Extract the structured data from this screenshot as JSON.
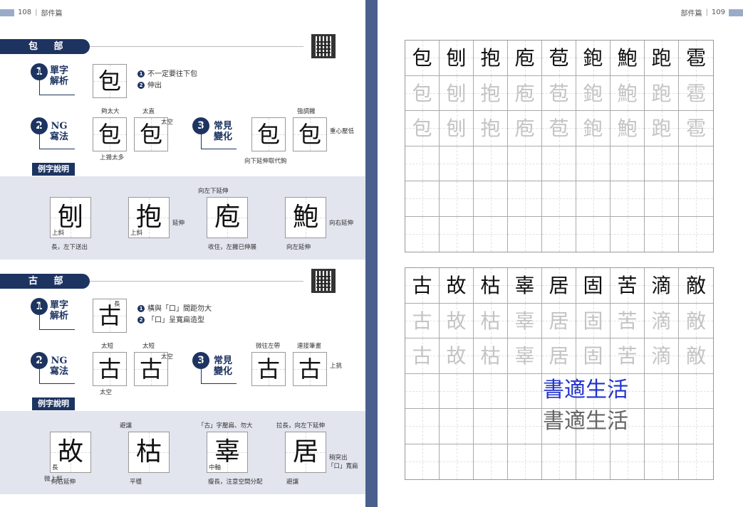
{
  "left": {
    "page_num": "108",
    "section": "部件篇",
    "p1": {
      "title": "包 部 件",
      "s1": {
        "num": "1",
        "label": "單字\n解析",
        "char": "包",
        "notes": [
          "不一定要往下包",
          "伸出"
        ]
      },
      "s2": {
        "num": "2",
        "label": "NG\n寫法",
        "boxes": [
          {
            "char": "包",
            "top": "夠太大",
            "bottom": "上揚太多"
          },
          {
            "char": "包",
            "top": "太直",
            "right": "太空"
          }
        ]
      },
      "s3": {
        "num": "3",
        "label": "常見\n變化",
        "boxes": [
          {
            "char": "包",
            "bottom": "向下延伸取代鉤"
          },
          {
            "char": "包",
            "top": "強調撇",
            "right": "重心壓低"
          }
        ]
      },
      "ex_title": "例字說明",
      "examples": [
        {
          "char": "刨",
          "in": "上斜",
          "below": "長，左下送出"
        },
        {
          "char": "抱",
          "in": "上斜",
          "right": "延伸"
        },
        {
          "char": "庖",
          "top": "向左下延伸",
          "below": "收住，左撇已伸展"
        },
        {
          "char": "鮑",
          "below": "向左延伸",
          "right": "向右延伸"
        }
      ]
    },
    "p2": {
      "title": "古 部 件",
      "s1": {
        "num": "1",
        "label": "單字\n解析",
        "char": "古",
        "inner": "長",
        "notes": [
          "橫與「口」間距勿大",
          "「口」呈寬扁造型"
        ]
      },
      "s2": {
        "num": "2",
        "label": "NG\n寫法",
        "boxes": [
          {
            "char": "古",
            "top": "太短",
            "bottom": "太空"
          },
          {
            "char": "古",
            "top": "太短",
            "right": "太空"
          }
        ]
      },
      "s3": {
        "num": "3",
        "label": "常見\n變化",
        "boxes": [
          {
            "char": "古",
            "top": "微往左帶"
          },
          {
            "char": "古",
            "top": "連接筆畫",
            "right": "上挑"
          }
        ]
      },
      "ex_title": "例字說明",
      "examples": [
        {
          "char": "故",
          "in": "長",
          "below_left": "微上斜",
          "below": "向右延伸"
        },
        {
          "char": "枯",
          "top": "避讓",
          "below": "平穩"
        },
        {
          "char": "辜",
          "top": "「古」字壓扁、勿大",
          "in": "中軸",
          "below": "瘦長，注意空間分配"
        },
        {
          "char": "居",
          "top": "拉長，向左下延伸",
          "right": "稍突出",
          "right2": "「口」寬扁",
          "below": "避讓"
        }
      ]
    }
  },
  "right": {
    "page_num": "109",
    "section": "部件篇",
    "grid1": [
      "包",
      "刨",
      "抱",
      "庖",
      "苞",
      "鉋",
      "鮑",
      "跑",
      "雹"
    ],
    "grid2": [
      "古",
      "故",
      "枯",
      "辜",
      "居",
      "固",
      "苦",
      "滴",
      "敵"
    ],
    "watermark": "書適生活"
  },
  "colors": {
    "navy": "#1d3461",
    "band": "#e2e4ee",
    "spine": "#4a5f8e",
    "wm_blue": "#2233cc",
    "wm_gray": "#666666"
  }
}
